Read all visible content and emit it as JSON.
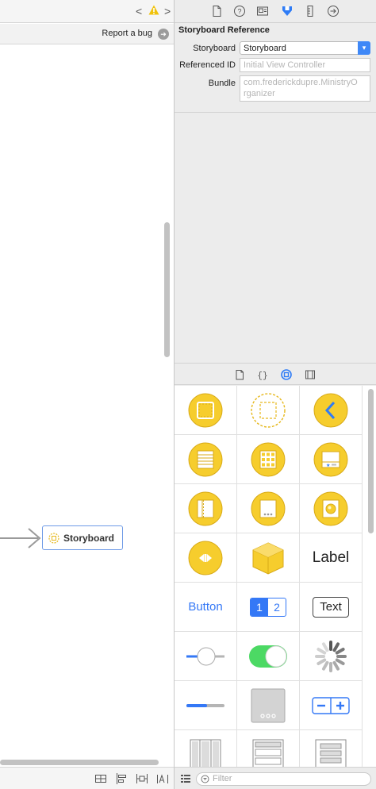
{
  "toolbar": {
    "nav_back": "<",
    "nav_forward": ">",
    "warning_icon": "warning-triangle-icon",
    "report_bug_label": "Report a bug"
  },
  "canvas": {
    "storyboard_reference_label": "Storyboard"
  },
  "inspector": {
    "section_title": "Storyboard Reference",
    "fields": {
      "storyboard_label": "Storyboard",
      "storyboard_value": "Storyboard",
      "referenced_id_label": "Referenced ID",
      "referenced_id_placeholder": "Initial View Controller",
      "bundle_label": "Bundle",
      "bundle_placeholder_line1": "com.frederickdupre.MinistryO",
      "bundle_placeholder_line2": "rganizer"
    },
    "tabs": [
      "file-inspector-icon",
      "quick-help-icon",
      "identity-inspector-icon",
      "attributes-inspector-icon",
      "size-inspector-icon",
      "connections-inspector-icon"
    ]
  },
  "library": {
    "tabs": [
      "file-template-icon",
      "code-snippet-icon",
      "object-library-icon",
      "media-library-icon"
    ],
    "items": {
      "label_text": "Label",
      "button_text": "Button",
      "segment_1": "1",
      "segment_2": "2",
      "textfield_text": "Text"
    },
    "filter_placeholder": "Filter"
  },
  "colors": {
    "accent": "#3478f6",
    "object_yellow": "#f6cd2d",
    "object_yellow_stroke": "#d8aa17",
    "switch_green": "#4cd964",
    "warning": "#f0c20b"
  }
}
